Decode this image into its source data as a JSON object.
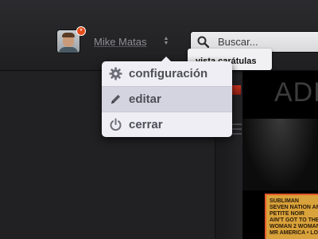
{
  "header": {
    "user": {
      "name": "Mike Matas",
      "notification_count": "*"
    },
    "search": {
      "placeholder": "Buscar..."
    },
    "tooltip": "vista carátulas"
  },
  "user_menu": {
    "items": [
      {
        "label": "configuración",
        "icon": "gear-icon"
      },
      {
        "label": "editar",
        "icon": "pencil-icon",
        "active": true
      },
      {
        "label": "cerrar",
        "icon": "power-icon"
      }
    ]
  },
  "content": {
    "banner_text": "ADE",
    "poster_lines": [
      "SUBLIMAN",
      "SEVEN NATION ARMY",
      "PETITE NOIR",
      "AIN'T GOT TO THE BACK",
      "WOMAN 2 WOMAN",
      "MR AMERICA • LOSE IT"
    ]
  },
  "colors": {
    "badge": "#e64a19",
    "menu_background": "#eeeef4",
    "menu_active": "#d4d4e0",
    "accent_red": "#c3331f"
  }
}
